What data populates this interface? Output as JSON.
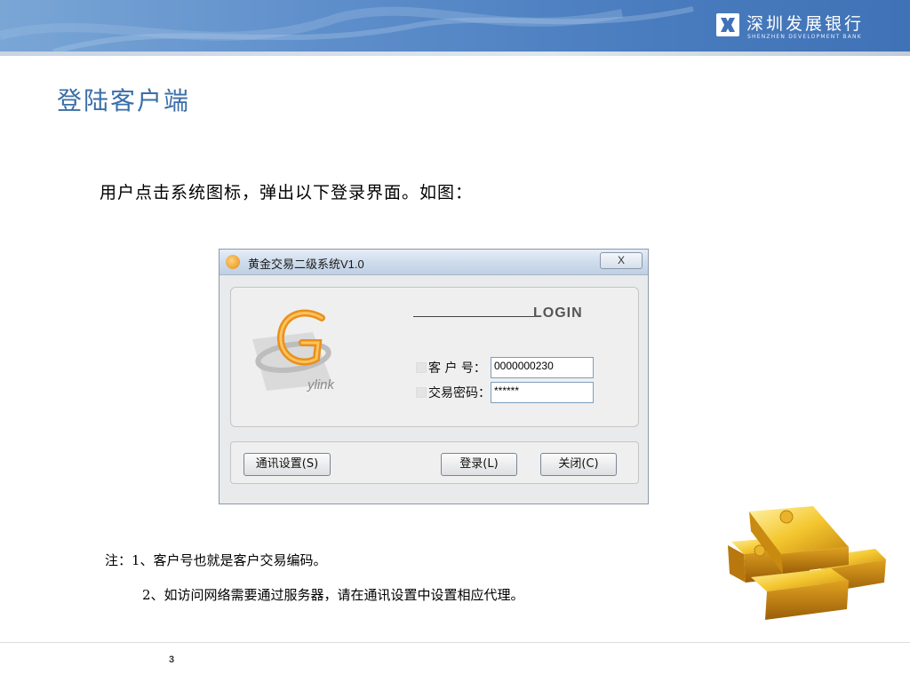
{
  "header": {
    "bank_name": "深圳发展银行",
    "bank_name_en": "SHENZHEN DEVELOPMENT BANK",
    "colors": {
      "header_blue": "#4a7dbf",
      "title_blue": "#3a6ea8"
    }
  },
  "page": {
    "title": "登陆客户端",
    "intro": "用户点击系统图标，弹出以下登录界面。如图：",
    "page_number": "3"
  },
  "dialog": {
    "window_title": "黄金交易二级系统V1.0",
    "close_label": "X",
    "logo_text": "ylink",
    "login_heading": "LOGIN",
    "fields": [
      {
        "label": "客 户 号：",
        "value": "0000000230"
      },
      {
        "label": "交易密码：",
        "value": "******"
      }
    ],
    "buttons": {
      "settings": "通讯设置(S)",
      "login": "登录(L)",
      "close": "关闭(C)"
    }
  },
  "notes": {
    "note1": "注：1、客户号也就是客户交易编码。",
    "note2": "2、如访问网络需要通过服务器，请在通讯设置中设置相应代理。"
  },
  "icons": [
    "bank-logo-icon",
    "app-icon",
    "close-icon",
    "ylink-logo-icon",
    "gold-bars-image"
  ]
}
